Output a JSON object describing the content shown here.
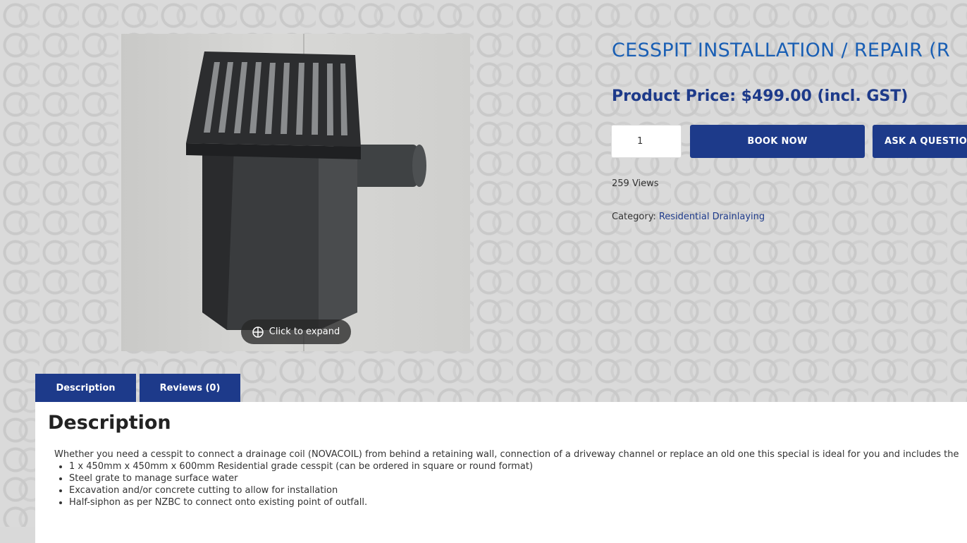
{
  "product": {
    "title": "CESSPIT INSTALLATION / REPAIR (R",
    "price": "Product Price: $499.00 (incl. GST)",
    "quantity": "1",
    "book_label": "BOOK NOW",
    "ask_label": "ASK A QUESTION",
    "views": "259 Views",
    "category_label": "Category:",
    "category_link": "Residential Drainlaying",
    "expand_label": "Click to expand"
  },
  "tabs": [
    {
      "label": "Description"
    },
    {
      "label": "Reviews (0)"
    }
  ],
  "description": {
    "heading": "Description",
    "intro": "Whether you need a cesspit to connect a drainage coil (NOVACOIL) from behind a retaining wall, connection of a driveway channel or replace an old one this special is ideal for you and includes the",
    "items": [
      "1 x 450mm x 450mm x 600mm Residential grade cesspit (can be ordered in square or round format)",
      "Steel grate to manage surface water",
      "Excavation and/or concrete cutting to allow for installation",
      "Half-siphon as per NZBC to connect onto existing point of outfall."
    ]
  },
  "colors": {
    "brand_blue": "#1d3a8a",
    "title_blue": "#1a5fb4"
  }
}
